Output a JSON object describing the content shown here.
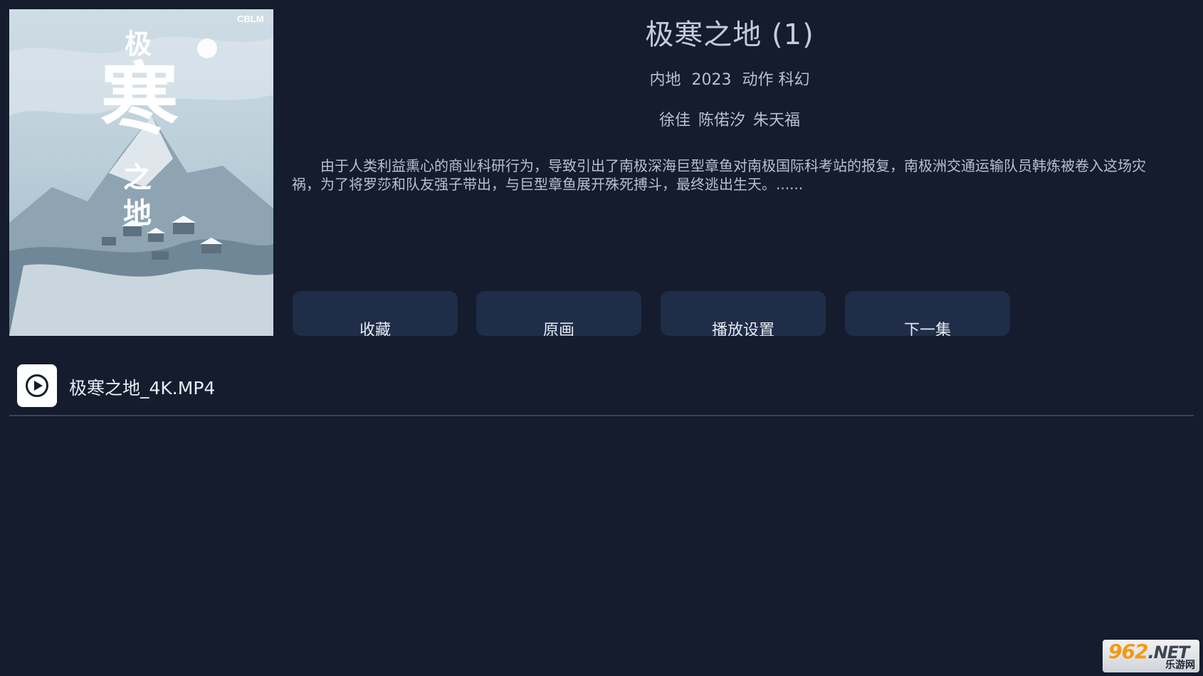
{
  "movie": {
    "title": "极寒之地 (1)",
    "meta": {
      "region": "内地",
      "year": "2023",
      "genres": "动作 科幻"
    },
    "cast": [
      "徐佳",
      "陈偌汐",
      "朱天福"
    ],
    "description": "由于人类利益熏心的商业科研行为，导致引出了南极深海巨型章鱼对南极国际科考站的报复，南极洲交通运输队员韩炼被卷入这场灾祸，为了将罗莎和队友强子带出，与巨型章鱼展开殊死搏斗，最终逃出生天。......"
  },
  "poster": {
    "title_chars": [
      "极",
      "寒",
      "之",
      "地"
    ],
    "logo": "CBLM"
  },
  "actions": [
    {
      "label": "收藏",
      "name": "favorite-button"
    },
    {
      "label": "原画",
      "name": "quality-button"
    },
    {
      "label": "播放设置",
      "name": "play-settings-button"
    },
    {
      "label": "下一集",
      "name": "next-episode-button"
    }
  ],
  "episodes": [
    {
      "file": "极寒之地_4K.MP4",
      "icon": "play-circle-icon"
    }
  ],
  "watermark": {
    "top": "962",
    "net": ".NET",
    "bottom": "乐游网"
  },
  "colors": {
    "background": "#141c2e",
    "button": "#1f2d48",
    "divider": "#3a4456"
  }
}
